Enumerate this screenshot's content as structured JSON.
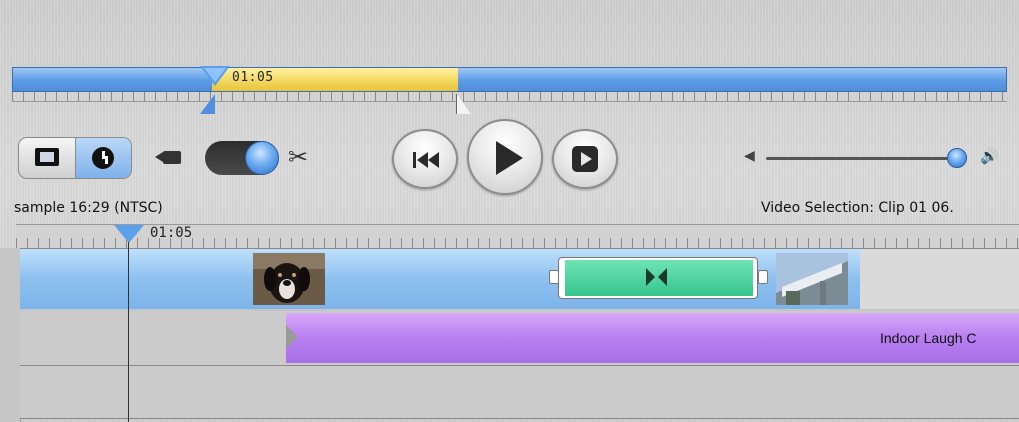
{
  "scrubber": {
    "time": "01:05"
  },
  "controls": {
    "view_toggle": [
      "clip-view-icon",
      "timeline-view-icon"
    ],
    "mode_camera_icon": "camera-icon",
    "mode_edit_icon": "scissors-icon",
    "transport": [
      "rewind-icon",
      "play-icon",
      "fullscreen-play-icon"
    ],
    "volume_low_icon": "speaker-low-icon",
    "volume_high_icon": "speaker-high-icon",
    "volume_level": 0.94
  },
  "info": {
    "project": "sample  16:29 (NTSC)",
    "selection": "Video Selection: Clip 01 06."
  },
  "timeline": {
    "time": "01:05",
    "audio_clip_label": "Indoor Laugh C",
    "transition_icon": "transition-icon"
  },
  "colors": {
    "scrubber_blue": "#5d9be6",
    "selection_yellow": "#f2d55b",
    "transition_green": "#37c58e",
    "audio_purple": "#b77ff0"
  }
}
